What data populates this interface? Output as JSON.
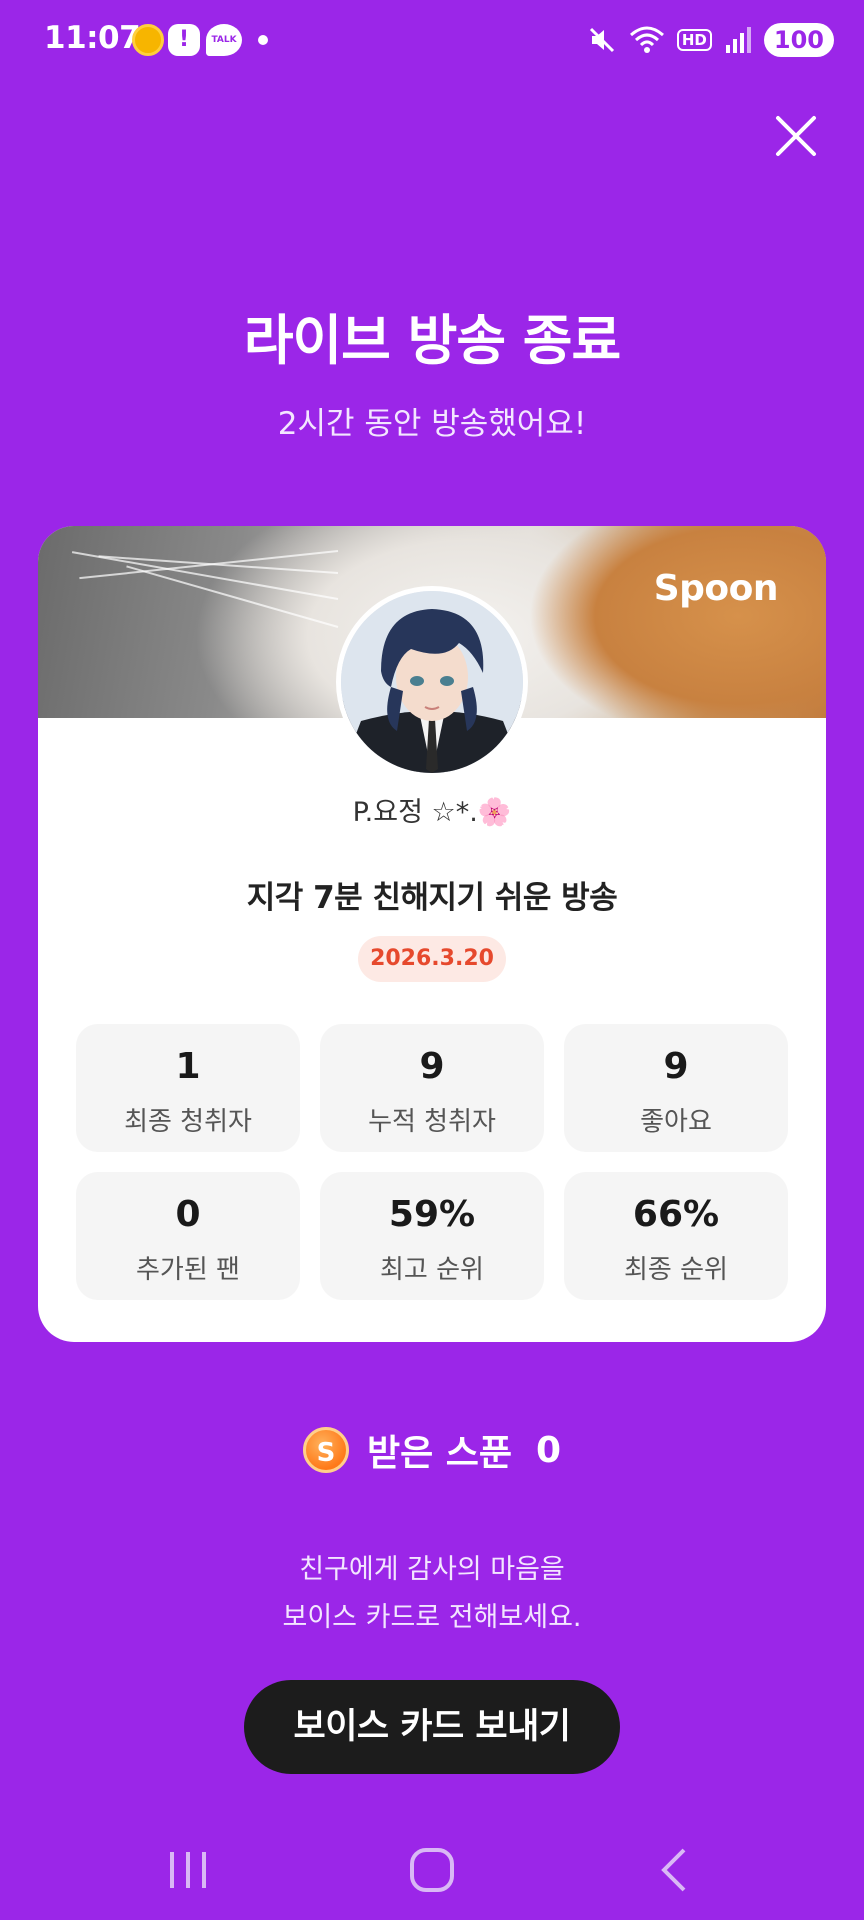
{
  "status_bar": {
    "time": "11:07",
    "talk_label": "TALK",
    "alert_label": "!",
    "hd_label": "HD",
    "battery": "100"
  },
  "header": {
    "title": "라이브 방송 종료",
    "subtitle": "2시간 동안 방송했어요!"
  },
  "card": {
    "brand": "Spoon",
    "nickname": "P.요정 ☆*.🌸",
    "live_title": "지각 7분 친해지기 쉬운 방송",
    "date": "2026.3.20",
    "stats": [
      {
        "value": "1",
        "label": "최종 청취자"
      },
      {
        "value": "9",
        "label": "누적 청취자"
      },
      {
        "value": "9",
        "label": "좋아요"
      },
      {
        "value": "0",
        "label": "추가된 팬"
      },
      {
        "value": "59%",
        "label": "최고 순위"
      },
      {
        "value": "66%",
        "label": "최종 순위"
      }
    ]
  },
  "received": {
    "coin_symbol": "S",
    "label": "받은 스푼",
    "count": "0"
  },
  "thanks": {
    "line1": "친구에게 감사의 마음을",
    "line2": "보이스 카드로 전해보세요."
  },
  "cta": {
    "label": "보이스 카드 보내기"
  },
  "colors": {
    "background": "#9B26E8",
    "card": "#FFFFFF",
    "date_text": "#E6492D",
    "cta_bg": "#1C1C1C"
  }
}
